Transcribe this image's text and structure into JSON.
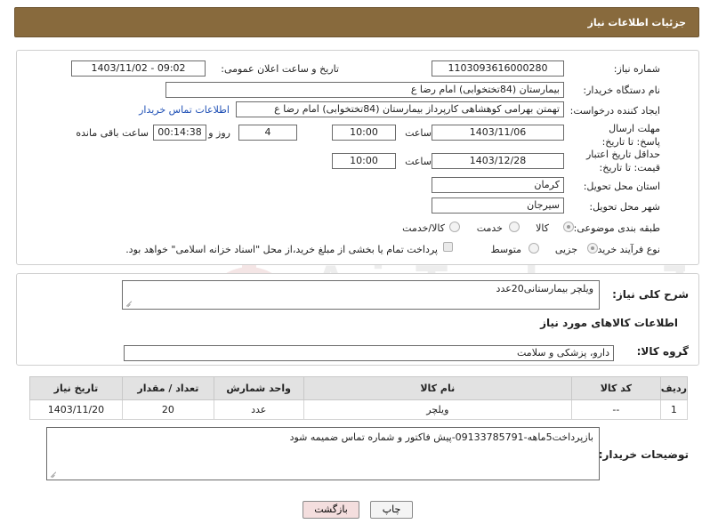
{
  "header": {
    "title": "جزئیات اطلاعات نیاز"
  },
  "form": {
    "need_number_label": "شماره نیاز:",
    "need_number": "1103093616000280",
    "announce_label": "تاریخ و ساعت اعلان عمومی:",
    "announce_value": "1403/11/02 - 09:02",
    "buyer_label": "نام دستگاه خریدار:",
    "buyer_value": "بیمارستان (84تختخوابی) امام رضا  ع",
    "creator_label": "ایجاد کننده درخواست:",
    "creator_value": "تهمتن بهرامی کوهشاهی کارپرداز بیمارستان (84تختخوابی) امام رضا  ع",
    "contact_link": "اطلاعات تماس خریدار",
    "deadline_label": "مهلت ارسال پاسخ: تا تاریخ:",
    "deadline_date": "1403/11/06",
    "time_label": "ساعت",
    "deadline_time": "10:00",
    "days_value": "4",
    "days_label": "روز و",
    "remaining_value": "00:14:38",
    "remaining_label": "ساعت باقی مانده",
    "validity_label": "حداقل تاریخ اعتبار قیمت: تا تاریخ:",
    "validity_date": "1403/12/28",
    "validity_time": "10:00",
    "province_label": "استان محل تحویل:",
    "province_value": "کرمان",
    "city_label": "شهر محل تحویل:",
    "city_value": "سیرجان",
    "category_label": "طبقه بندی موضوعی:",
    "category_options": [
      "کالا",
      "خدمت",
      "کالا/خدمت"
    ],
    "category_selected": "کالا",
    "process_label": "نوع فرآیند خرید :",
    "process_options": [
      "جزیی",
      "متوسط"
    ],
    "process_selected": "جزیی",
    "payment_note": "پرداخت تمام یا بخشی از مبلغ خرید،از محل \"اسناد خزانه اسلامی\" خواهد بود."
  },
  "summary": {
    "label": "شرح کلی نیاز:",
    "value": "ویلچر بیمارستانی20عدد"
  },
  "goods_section": {
    "title": "اطلاعات کالاهای مورد نیاز",
    "group_label": "گروه کالا:",
    "group_value": "دارو، پزشکی و سلامت"
  },
  "table": {
    "headers": [
      "ردیف",
      "کد کالا",
      "نام کالا",
      "واحد شمارش",
      "تعداد / مقدار",
      "تاریخ نیاز"
    ],
    "rows": [
      [
        "1",
        "--",
        "ویلچر",
        "عدد",
        "20",
        "1403/11/20"
      ]
    ]
  },
  "buyer_notes": {
    "label": "توضیحات خریدار:",
    "value": "بازپرداخت5ماهه-09133785791-پیش فاکتور و شماره تماس ضمیمه شود"
  },
  "buttons": {
    "print": "چاپ",
    "back": "بازگشت"
  },
  "watermark": {
    "text": "AriaTender.neT"
  },
  "colors": {
    "header_bg": "#886a3d",
    "link": "#1e4fb5",
    "back_button": "#f4dede"
  }
}
